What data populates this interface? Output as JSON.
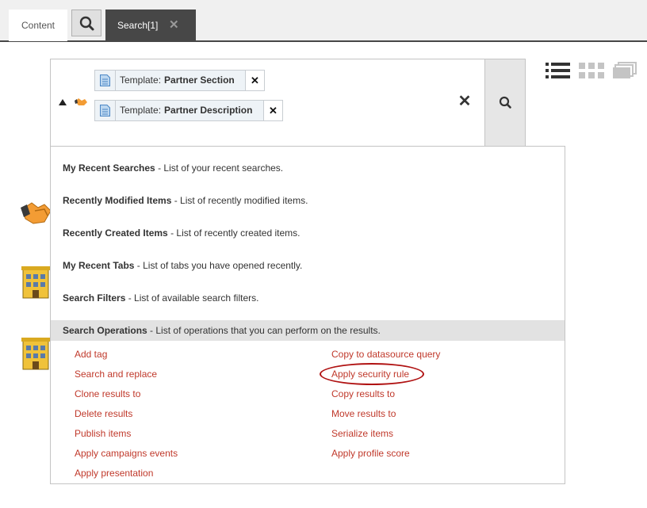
{
  "tabs": {
    "content_label": "Content",
    "search_tab_label": "Search[1]",
    "search_tab_close": "✕"
  },
  "search": {
    "filters": [
      {
        "key": "Template:",
        "value": "Partner Section"
      },
      {
        "key": "Template:",
        "value": "Partner Description"
      }
    ],
    "chip_remove": "✕",
    "clear": "✕"
  },
  "dropdown": {
    "items": [
      {
        "title": "My Recent Searches",
        "desc": " - List of your recent searches."
      },
      {
        "title": "Recently Modified Items",
        "desc": " - List of recently modified items."
      },
      {
        "title": "Recently Created Items",
        "desc": " - List of recently created items."
      },
      {
        "title": "My Recent Tabs",
        "desc": " - List of tabs you have opened recently."
      },
      {
        "title": "Search Filters",
        "desc": " - List of available search filters."
      }
    ],
    "operations_header": {
      "title": "Search Operations",
      "desc": " - List of operations that you can perform on the results."
    },
    "operations_left": [
      "Add tag",
      "Search and replace",
      "Clone results to",
      "Delete results",
      "Publish items",
      "Apply campaigns events",
      "Apply presentation"
    ],
    "operations_right": [
      "Copy to datasource query",
      "Apply security rule",
      "Copy results to",
      "Move results to",
      "Serialize items",
      "Apply profile score"
    ]
  },
  "icons": {
    "search": "search-icon",
    "document": "document-icon",
    "handshake": "handshake-icon",
    "building": "building-icon",
    "list_view": "list-view-icon",
    "grid_view": "grid-view-icon",
    "stack_view": "stack-view-icon",
    "expand": "expand-arrow-icon"
  },
  "colors": {
    "tab_active_bg": "#474747",
    "operation_link": "#c0392b",
    "highlight_ring": "#b01212"
  }
}
